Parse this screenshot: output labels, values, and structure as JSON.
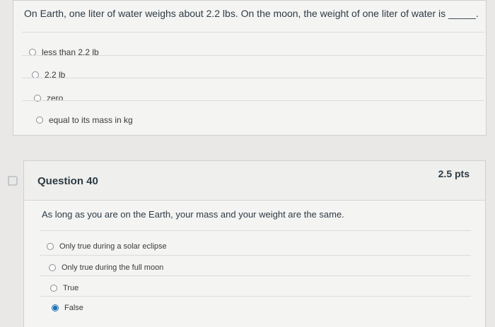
{
  "question39": {
    "prompt": "On Earth, one liter of water weighs about 2.2 lbs. On the moon, the weight of one liter of water is _____.",
    "answers": [
      {
        "label": "less than 2.2 lb",
        "selected": false
      },
      {
        "label": "2.2 lb",
        "selected": false
      },
      {
        "label": "zero",
        "selected": false
      },
      {
        "label": "equal to its mass in kg",
        "selected": false
      }
    ]
  },
  "question40": {
    "title": "Question 40",
    "points": "2.5 pts",
    "prompt": "As long as you are on the Earth, your mass and your weight are the same.",
    "answers": [
      {
        "label": "Only true during a solar eclipse",
        "selected": false
      },
      {
        "label": "Only true during the full moon",
        "selected": false
      },
      {
        "label": "True",
        "selected": false
      },
      {
        "label": "False",
        "selected": true
      }
    ]
  },
  "icons": {
    "flag": "bookmark-flag-icon"
  },
  "colors": {
    "accent": "#1f6fb4",
    "text": "#2d3b45",
    "background": "#e9e8e6"
  }
}
